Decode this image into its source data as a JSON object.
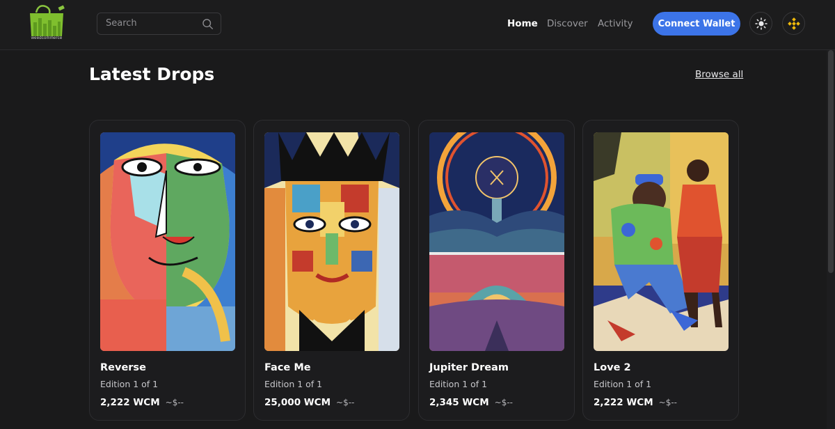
{
  "brand": {
    "logo_text": "weedcommerce",
    "accent": "#3c74e8"
  },
  "search": {
    "placeholder": "Search",
    "icon": "search-icon"
  },
  "nav": {
    "items": [
      {
        "label": "Home",
        "active": true
      },
      {
        "label": "Discover",
        "active": false
      },
      {
        "label": "Activity",
        "active": false
      }
    ],
    "connect_label": "Connect Wallet",
    "theme_icon": "sun-icon",
    "network_icon": "bnb-icon"
  },
  "section": {
    "title": "Latest Drops",
    "browse_label": "Browse all"
  },
  "cards": [
    {
      "title": "Reverse",
      "edition": "Edition 1 of 1",
      "price": "2,222 WCM",
      "usd": "~$--"
    },
    {
      "title": "Face Me",
      "edition": "Edition 1 of 1",
      "price": "25,000 WCM",
      "usd": "~$--"
    },
    {
      "title": "Jupiter Dream",
      "edition": "Edition 1 of 1",
      "price": "2,345 WCM",
      "usd": "~$--"
    },
    {
      "title": "Love 2",
      "edition": "Edition 1 of 1",
      "price": "2,222 WCM",
      "usd": "~$--"
    }
  ]
}
